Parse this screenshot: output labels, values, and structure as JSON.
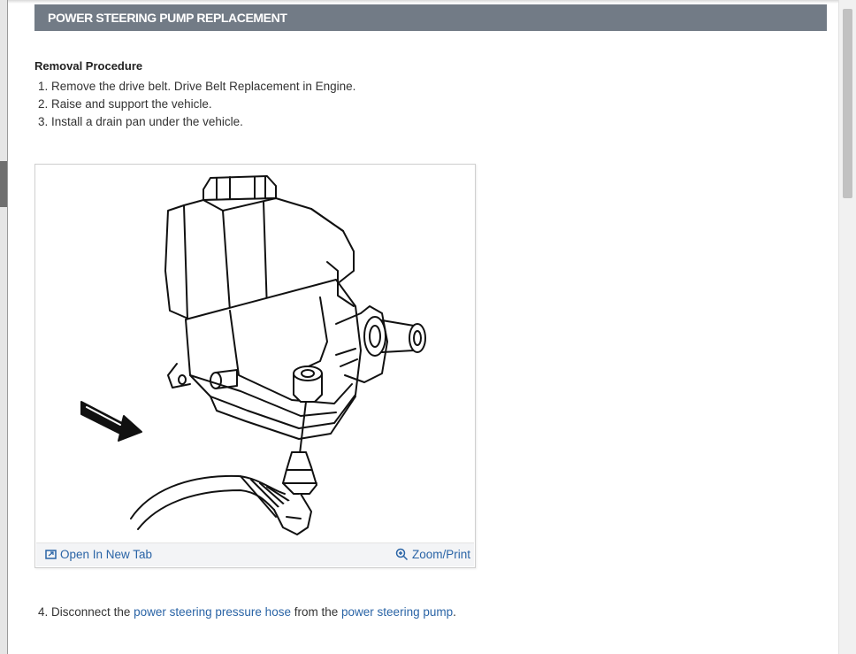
{
  "header": {
    "title": "POWER STEERING PUMP REPLACEMENT"
  },
  "removal": {
    "heading": "Removal Procedure",
    "steps": [
      "1. Remove the drive belt. Drive Belt Replacement in Engine.",
      "2. Raise and support the vehicle.",
      "3. Install a drain pan under the vehicle."
    ]
  },
  "figure": {
    "image_description": "power-steering-pump-line-drawing",
    "open_new_tab_label": "Open In New Tab",
    "zoom_print_label": "Zoom/Print"
  },
  "step4": {
    "number": "4.",
    "prefix": "Disconnect the",
    "link1": "power steering pressure hose",
    "middle": "from the",
    "link2": "power steering pump",
    "suffix": "."
  },
  "colors": {
    "header_bg": "#727b86",
    "link": "#2a64a6",
    "text": "#333333"
  },
  "icons": {
    "open_new_tab": "external-tab-icon",
    "zoom": "zoom-in-icon"
  }
}
